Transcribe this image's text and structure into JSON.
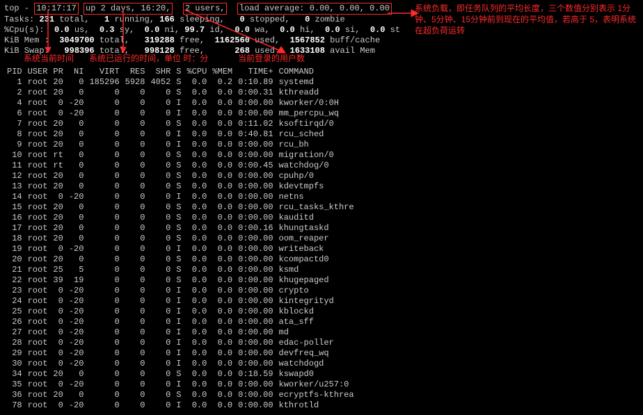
{
  "header": {
    "prefix": "top - ",
    "time": "10:17:17",
    "uptime": "up 2 days, 16:20,",
    "users": "2 users,",
    "load_label": "load average: 0.00, 0.00, 0.00",
    "tasks_line": "Tasks: 231 total,   1 running, 166 sleeping,   0 stopped,   0 zombie",
    "cpu_line": "%Cpu(s):  0.0 us,  0.3 sy,  0.0 ni, 99.7 id,  0.0 wa,  0.0 hi,  0.0 si,  0.0 st",
    "mem_line": "KiB Mem :  3049700 total,   319288 free,  1162560 used,  1567852 buff/cache",
    "swap_line": "KiB Swap:   998396 total,   998128 free,      268 used.  1633108 avail Mem"
  },
  "annotations": {
    "time": "系统当前时间",
    "uptime": "系统已运行的时间，单位 时：分",
    "users": "当前登录的用户数",
    "load": "系统负载，即任务队列的平均长度，三个数值分别表示 1分钟、5分钟、15分钟前到现在的平均值，若高于 5，表明系统在超负荷运转"
  },
  "columns": [
    "PID",
    "USER",
    "PR",
    "NI",
    "VIRT",
    "RES",
    "SHR",
    "S",
    "%CPU",
    "%MEM",
    "TIME+",
    "COMMAND"
  ],
  "processes": [
    {
      "pid": 1,
      "user": "root",
      "pr": "20",
      "ni": "0",
      "virt": "185296",
      "res": "5928",
      "shr": "4052",
      "s": "S",
      "cpu": "0.0",
      "mem": "0.2",
      "time": "0:10.89",
      "cmd": "systemd"
    },
    {
      "pid": 2,
      "user": "root",
      "pr": "20",
      "ni": "0",
      "virt": "0",
      "res": "0",
      "shr": "0",
      "s": "S",
      "cpu": "0.0",
      "mem": "0.0",
      "time": "0:00.31",
      "cmd": "kthreadd"
    },
    {
      "pid": 4,
      "user": "root",
      "pr": "0",
      "ni": "-20",
      "virt": "0",
      "res": "0",
      "shr": "0",
      "s": "I",
      "cpu": "0.0",
      "mem": "0.0",
      "time": "0:00.00",
      "cmd": "kworker/0:0H"
    },
    {
      "pid": 6,
      "user": "root",
      "pr": "0",
      "ni": "-20",
      "virt": "0",
      "res": "0",
      "shr": "0",
      "s": "I",
      "cpu": "0.0",
      "mem": "0.0",
      "time": "0:00.00",
      "cmd": "mm_percpu_wq"
    },
    {
      "pid": 7,
      "user": "root",
      "pr": "20",
      "ni": "0",
      "virt": "0",
      "res": "0",
      "shr": "0",
      "s": "S",
      "cpu": "0.0",
      "mem": "0.0",
      "time": "0:11.02",
      "cmd": "ksoftirqd/0"
    },
    {
      "pid": 8,
      "user": "root",
      "pr": "20",
      "ni": "0",
      "virt": "0",
      "res": "0",
      "shr": "0",
      "s": "I",
      "cpu": "0.0",
      "mem": "0.0",
      "time": "0:40.81",
      "cmd": "rcu_sched"
    },
    {
      "pid": 9,
      "user": "root",
      "pr": "20",
      "ni": "0",
      "virt": "0",
      "res": "0",
      "shr": "0",
      "s": "I",
      "cpu": "0.0",
      "mem": "0.0",
      "time": "0:00.00",
      "cmd": "rcu_bh"
    },
    {
      "pid": 10,
      "user": "root",
      "pr": "rt",
      "ni": "0",
      "virt": "0",
      "res": "0",
      "shr": "0",
      "s": "S",
      "cpu": "0.0",
      "mem": "0.0",
      "time": "0:00.00",
      "cmd": "migration/0"
    },
    {
      "pid": 11,
      "user": "root",
      "pr": "rt",
      "ni": "0",
      "virt": "0",
      "res": "0",
      "shr": "0",
      "s": "S",
      "cpu": "0.0",
      "mem": "0.0",
      "time": "0:00.45",
      "cmd": "watchdog/0"
    },
    {
      "pid": 12,
      "user": "root",
      "pr": "20",
      "ni": "0",
      "virt": "0",
      "res": "0",
      "shr": "0",
      "s": "S",
      "cpu": "0.0",
      "mem": "0.0",
      "time": "0:00.00",
      "cmd": "cpuhp/0"
    },
    {
      "pid": 13,
      "user": "root",
      "pr": "20",
      "ni": "0",
      "virt": "0",
      "res": "0",
      "shr": "0",
      "s": "S",
      "cpu": "0.0",
      "mem": "0.0",
      "time": "0:00.00",
      "cmd": "kdevtmpfs"
    },
    {
      "pid": 14,
      "user": "root",
      "pr": "0",
      "ni": "-20",
      "virt": "0",
      "res": "0",
      "shr": "0",
      "s": "I",
      "cpu": "0.0",
      "mem": "0.0",
      "time": "0:00.00",
      "cmd": "netns"
    },
    {
      "pid": 15,
      "user": "root",
      "pr": "20",
      "ni": "0",
      "virt": "0",
      "res": "0",
      "shr": "0",
      "s": "S",
      "cpu": "0.0",
      "mem": "0.0",
      "time": "0:00.00",
      "cmd": "rcu_tasks_kthre"
    },
    {
      "pid": 16,
      "user": "root",
      "pr": "20",
      "ni": "0",
      "virt": "0",
      "res": "0",
      "shr": "0",
      "s": "S",
      "cpu": "0.0",
      "mem": "0.0",
      "time": "0:00.00",
      "cmd": "kauditd"
    },
    {
      "pid": 17,
      "user": "root",
      "pr": "20",
      "ni": "0",
      "virt": "0",
      "res": "0",
      "shr": "0",
      "s": "S",
      "cpu": "0.0",
      "mem": "0.0",
      "time": "0:00.16",
      "cmd": "khungtaskd"
    },
    {
      "pid": 18,
      "user": "root",
      "pr": "20",
      "ni": "0",
      "virt": "0",
      "res": "0",
      "shr": "0",
      "s": "S",
      "cpu": "0.0",
      "mem": "0.0",
      "time": "0:00.00",
      "cmd": "oom_reaper"
    },
    {
      "pid": 19,
      "user": "root",
      "pr": "0",
      "ni": "-20",
      "virt": "0",
      "res": "0",
      "shr": "0",
      "s": "I",
      "cpu": "0.0",
      "mem": "0.0",
      "time": "0:00.00",
      "cmd": "writeback"
    },
    {
      "pid": 20,
      "user": "root",
      "pr": "20",
      "ni": "0",
      "virt": "0",
      "res": "0",
      "shr": "0",
      "s": "S",
      "cpu": "0.0",
      "mem": "0.0",
      "time": "0:00.00",
      "cmd": "kcompactd0"
    },
    {
      "pid": 21,
      "user": "root",
      "pr": "25",
      "ni": "5",
      "virt": "0",
      "res": "0",
      "shr": "0",
      "s": "S",
      "cpu": "0.0",
      "mem": "0.0",
      "time": "0:00.00",
      "cmd": "ksmd"
    },
    {
      "pid": 22,
      "user": "root",
      "pr": "39",
      "ni": "19",
      "virt": "0",
      "res": "0",
      "shr": "0",
      "s": "S",
      "cpu": "0.0",
      "mem": "0.0",
      "time": "0:00.00",
      "cmd": "khugepaged"
    },
    {
      "pid": 23,
      "user": "root",
      "pr": "0",
      "ni": "-20",
      "virt": "0",
      "res": "0",
      "shr": "0",
      "s": "I",
      "cpu": "0.0",
      "mem": "0.0",
      "time": "0:00.00",
      "cmd": "crypto"
    },
    {
      "pid": 24,
      "user": "root",
      "pr": "0",
      "ni": "-20",
      "virt": "0",
      "res": "0",
      "shr": "0",
      "s": "I",
      "cpu": "0.0",
      "mem": "0.0",
      "time": "0:00.00",
      "cmd": "kintegrityd"
    },
    {
      "pid": 25,
      "user": "root",
      "pr": "0",
      "ni": "-20",
      "virt": "0",
      "res": "0",
      "shr": "0",
      "s": "I",
      "cpu": "0.0",
      "mem": "0.0",
      "time": "0:00.00",
      "cmd": "kblockd"
    },
    {
      "pid": 26,
      "user": "root",
      "pr": "0",
      "ni": "-20",
      "virt": "0",
      "res": "0",
      "shr": "0",
      "s": "I",
      "cpu": "0.0",
      "mem": "0.0",
      "time": "0:00.00",
      "cmd": "ata_sff"
    },
    {
      "pid": 27,
      "user": "root",
      "pr": "0",
      "ni": "-20",
      "virt": "0",
      "res": "0",
      "shr": "0",
      "s": "I",
      "cpu": "0.0",
      "mem": "0.0",
      "time": "0:00.00",
      "cmd": "md"
    },
    {
      "pid": 28,
      "user": "root",
      "pr": "0",
      "ni": "-20",
      "virt": "0",
      "res": "0",
      "shr": "0",
      "s": "I",
      "cpu": "0.0",
      "mem": "0.0",
      "time": "0:00.00",
      "cmd": "edac-poller"
    },
    {
      "pid": 29,
      "user": "root",
      "pr": "0",
      "ni": "-20",
      "virt": "0",
      "res": "0",
      "shr": "0",
      "s": "I",
      "cpu": "0.0",
      "mem": "0.0",
      "time": "0:00.00",
      "cmd": "devfreq_wq"
    },
    {
      "pid": 30,
      "user": "root",
      "pr": "0",
      "ni": "-20",
      "virt": "0",
      "res": "0",
      "shr": "0",
      "s": "I",
      "cpu": "0.0",
      "mem": "0.0",
      "time": "0:00.00",
      "cmd": "watchdogd"
    },
    {
      "pid": 34,
      "user": "root",
      "pr": "20",
      "ni": "0",
      "virt": "0",
      "res": "0",
      "shr": "0",
      "s": "S",
      "cpu": "0.0",
      "mem": "0.0",
      "time": "0:18.59",
      "cmd": "kswapd0"
    },
    {
      "pid": 35,
      "user": "root",
      "pr": "0",
      "ni": "-20",
      "virt": "0",
      "res": "0",
      "shr": "0",
      "s": "I",
      "cpu": "0.0",
      "mem": "0.0",
      "time": "0:00.00",
      "cmd": "kworker/u257:0"
    },
    {
      "pid": 36,
      "user": "root",
      "pr": "20",
      "ni": "0",
      "virt": "0",
      "res": "0",
      "shr": "0",
      "s": "S",
      "cpu": "0.0",
      "mem": "0.0",
      "time": "0:00.00",
      "cmd": "ecryptfs-kthrea"
    },
    {
      "pid": 78,
      "user": "root",
      "pr": "0",
      "ni": "-20",
      "virt": "0",
      "res": "0",
      "shr": "0",
      "s": "I",
      "cpu": "0.0",
      "mem": "0.0",
      "time": "0:00.00",
      "cmd": "kthrotld"
    }
  ]
}
